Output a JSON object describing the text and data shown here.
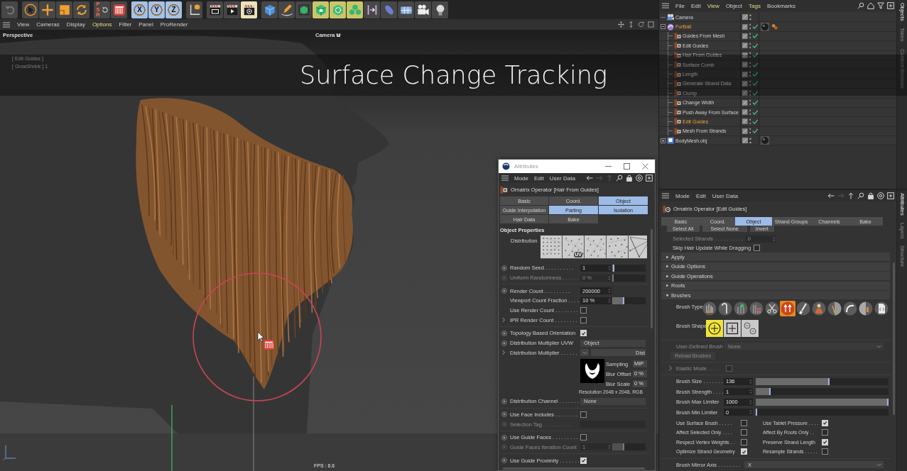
{
  "toolbar": [
    [
      {
        "kind": "undo",
        "active": false
      }
    ],
    [
      {
        "kind": "select",
        "active": false
      },
      {
        "kind": "move",
        "active": false
      },
      {
        "kind": "scale",
        "active": false
      },
      {
        "kind": "rotate",
        "active": false
      }
    ],
    [
      {
        "kind": "psr",
        "label": "PSR",
        "active": false
      },
      {
        "kind": "hair-tool",
        "active": false
      }
    ],
    [
      {
        "kind": "axis",
        "label": "X",
        "active": true
      },
      {
        "kind": "axis",
        "label": "Y",
        "active": true
      },
      {
        "kind": "axis",
        "label": "Z",
        "active": true
      }
    ],
    [
      {
        "kind": "coords",
        "active": false
      }
    ],
    [
      {
        "kind": "render-view",
        "active": false
      },
      {
        "kind": "render-picture",
        "active": false
      },
      {
        "kind": "render-settings",
        "active": true
      }
    ],
    [
      {
        "kind": "cube",
        "active": false
      },
      {
        "kind": "pen",
        "active": false
      },
      {
        "kind": "subdivision",
        "active": false
      },
      {
        "kind": "generator",
        "active": true
      },
      {
        "kind": "gear-cube",
        "active": true
      },
      {
        "kind": "cubes",
        "active": true
      },
      {
        "kind": "deformer",
        "active": false
      },
      {
        "kind": "field",
        "active": false
      },
      {
        "kind": "floor",
        "active": false
      },
      {
        "kind": "camera",
        "active": false
      },
      {
        "kind": "light",
        "active": false
      }
    ]
  ],
  "viewport": {
    "menu": [
      {
        "label": "View",
        "highlighted": false
      },
      {
        "label": "Cameras",
        "highlighted": false
      },
      {
        "label": "Display",
        "highlighted": false
      },
      {
        "label": "Options",
        "highlighted": true
      },
      {
        "label": "Filter",
        "highlighted": false
      },
      {
        "label": "Panel",
        "highlighted": false
      },
      {
        "label": "ProRender",
        "highlighted": false
      }
    ],
    "view_name": "Perspective",
    "camera": "Camera",
    "hud": [
      "[ Edit Guides ]",
      "[ GrowShrink ] 1"
    ],
    "fps": "FPS : 6.6"
  },
  "caption": "Surface Change Tracking",
  "attributes_window": {
    "title": "Attributes",
    "menu": [
      "Mode",
      "Edit",
      "User Data"
    ],
    "menu_icons": [
      {
        "kind": "back",
        "disabled": false
      },
      {
        "kind": "forward",
        "disabled": true
      },
      {
        "kind": "up",
        "disabled": true
      },
      {
        "kind": "search",
        "disabled": false
      },
      {
        "kind": "lock",
        "disabled": false
      },
      {
        "kind": "target",
        "disabled": false
      },
      {
        "kind": "new-panel",
        "disabled": false
      }
    ],
    "object": "Ornatrix Operator [Hair From Guides]",
    "tabs": [
      {
        "label": "Basic",
        "selected": false
      },
      {
        "label": "Coord.",
        "selected": false
      },
      {
        "label": "Object",
        "selected": true
      },
      {
        "label": "Guide Interpolation",
        "selected": false
      },
      {
        "label": "Parting",
        "selected": true
      },
      {
        "label": "Isolation",
        "selected": true
      },
      {
        "label": "Hair Data",
        "selected": false
      },
      {
        "label": "Bake",
        "selected": false
      }
    ],
    "section": "Object Properties",
    "distribution": {
      "label": "Distribution",
      "options": [
        {
          "kind": "grid",
          "selected": false
        },
        {
          "kind": "scatter",
          "badge": "UV",
          "selected": false
        },
        {
          "kind": "scatter",
          "selected": false
        },
        {
          "kind": "even",
          "selected": false
        },
        {
          "kind": "mesh",
          "selected": false
        }
      ]
    },
    "groups": [
      [
        {
          "kind": "number",
          "label": "Random Seed . . . . . . . . . .",
          "value": "1",
          "keyframe": true,
          "expandable": false,
          "disabled": false,
          "level": 0.02
        },
        {
          "kind": "number",
          "label": "Uniform Randomness . . . . . .",
          "value": "0 %",
          "keyframe": true,
          "expandable": false,
          "disabled": true,
          "level": 0
        }
      ],
      [
        {
          "kind": "number",
          "label": "Render Count . . . . . . . . .",
          "value": "200000",
          "keyframe": true,
          "expandable": false,
          "disabled": false
        },
        {
          "kind": "number",
          "label": "Viewport Count Fraction . . . .",
          "value": "10 %",
          "keyframe": false,
          "expandable": false,
          "disabled": false,
          "level": 0.34
        },
        {
          "kind": "checkbox",
          "label": "Use Render Count . . . . . . . .",
          "checked": false,
          "keyframe": false,
          "expandable": false,
          "disabled": false
        },
        {
          "kind": "checkbox",
          "label": "IPR Render Count . . . . . . . .",
          "checked": false,
          "keyframe": false,
          "expandable": true,
          "disabled": false
        }
      ],
      [
        {
          "kind": "checkbox",
          "label": "Topology Based Orientation",
          "checked": true,
          "keyframe": true,
          "expandable": false,
          "disabled": false
        },
        {
          "kind": "dropdown",
          "label": "Distribution Multiplier UVW",
          "value": "Object",
          "keyframe": true,
          "expandable": false,
          "disabled": false
        },
        {
          "kind": "shader",
          "label": "Distribution Multiplier . . . . . .",
          "button": "Dist",
          "keyframe": false,
          "expandable": true,
          "disabled": false
        },
        {
          "kind": "bitmap",
          "props": [
            {
              "label": "Sampling",
              "value": "MIP"
            },
            {
              "label": "Blur Offset",
              "value": "0 %"
            },
            {
              "label": "Blur Scale",
              "value": "0 %"
            }
          ]
        },
        {
          "kind": "note",
          "text": "Resolution 2048 x 2048, RGB"
        },
        {
          "kind": "dropdown",
          "label": "Distribution Channel . . . . . . .",
          "value": "None",
          "keyframe": true,
          "expandable": false,
          "disabled": false
        }
      ],
      [
        {
          "kind": "checkbox",
          "label": "Use Face Includes . . . . . . . .",
          "checked": false,
          "keyframe": true,
          "expandable": false,
          "disabled": false
        },
        {
          "kind": "field",
          "label": "Selection Tag . . . . . . . . . .",
          "keyframe": true,
          "expandable": false,
          "disabled": true
        }
      ],
      [
        {
          "kind": "checkbox",
          "label": "Use Guide Faces . . . . . . . . .",
          "checked": false,
          "keyframe": true,
          "expandable": false,
          "disabled": false
        },
        {
          "kind": "number",
          "label": "Guide Faces Iteration Count",
          "value": "1",
          "keyframe": true,
          "expandable": false,
          "disabled": true,
          "level": 0.34
        }
      ],
      [
        {
          "kind": "checkbox",
          "label": "Use Guide Proximity . . . . . . .",
          "checked": true,
          "keyframe": true,
          "expandable": false,
          "disabled": false
        }
      ]
    ]
  },
  "object_manager": {
    "menu": [
      {
        "label": "File",
        "highlighted": false
      },
      {
        "label": "Edit",
        "highlighted": false
      },
      {
        "label": "View",
        "highlighted": true
      },
      {
        "label": "Object",
        "highlighted": false
      },
      {
        "label": "Tags",
        "highlighted": true
      },
      {
        "label": "Bookmarks",
        "highlighted": false
      }
    ],
    "menu_icons": [
      {
        "kind": "search",
        "disabled": false
      },
      {
        "kind": "home",
        "disabled": false
      },
      {
        "kind": "filter",
        "disabled": false
      },
      {
        "kind": "new-panel",
        "disabled": false
      }
    ],
    "tree": [
      {
        "name": "Camera",
        "kind": "camera",
        "selected": false
      },
      {
        "name": "FurBall",
        "kind": "furball",
        "selected": true,
        "expanded": true,
        "enabled": true,
        "tags": [
          {
            "kind": "material"
          },
          {
            "kind": "hair"
          }
        ],
        "children": [
          {
            "name": "Guides From Mesh",
            "kind": "operator",
            "selected": false,
            "enabled": true
          },
          {
            "name": "Edit Guides",
            "kind": "operator",
            "selected": false,
            "enabled": true
          },
          {
            "name": "Hair From Guides",
            "kind": "operator",
            "selected": false,
            "enabled": true
          },
          {
            "name": "Surface Comb",
            "kind": "operator",
            "selected": false,
            "enabled": true
          },
          {
            "name": "Length",
            "kind": "operator",
            "selected": false,
            "enabled": true
          },
          {
            "name": "Generate Strand Data",
            "kind": "operator",
            "selected": false,
            "enabled": true
          },
          {
            "name": "Clump",
            "kind": "operator",
            "selected": false,
            "enabled": true
          },
          {
            "name": "Change Width",
            "kind": "operator",
            "selected": false,
            "enabled": true
          },
          {
            "name": "Push Away From Surface",
            "kind": "operator",
            "selected": false,
            "enabled": true
          },
          {
            "name": "Edit Guides",
            "kind": "operator",
            "selected": true,
            "enabled": true
          },
          {
            "name": "Mesh From Strands",
            "kind": "operator",
            "selected": false,
            "enabled": true
          }
        ]
      },
      {
        "name": "BodyMesh.obj",
        "kind": "mesh",
        "selected": false,
        "expanded": false,
        "tags": [
          {
            "kind": "material"
          }
        ]
      }
    ],
    "side_tabs": [
      {
        "label": "Objects",
        "selected": true
      },
      {
        "label": "Takes",
        "selected": false
      },
      {
        "label": "Content Browser",
        "selected": false
      }
    ]
  },
  "attribute_manager": {
    "menu": [
      "Mode",
      "Edit",
      "User Data"
    ],
    "menu_icons": [
      {
        "kind": "back",
        "disabled": false
      },
      {
        "kind": "forward",
        "disabled": true
      },
      {
        "kind": "up",
        "disabled": false
      },
      {
        "kind": "search",
        "disabled": false
      },
      {
        "kind": "lock",
        "disabled": false
      },
      {
        "kind": "target",
        "disabled": false
      },
      {
        "kind": "new-panel",
        "disabled": false
      }
    ],
    "object": "Ornatrix Operator [Edit Guides]",
    "tabs": [
      {
        "label": "Basic",
        "selected": false
      },
      {
        "label": "Coord.",
        "selected": false
      },
      {
        "label": "Object",
        "selected": true
      },
      {
        "label": "Strand Groups",
        "selected": false
      },
      {
        "label": "Channels",
        "selected": false
      },
      {
        "label": "Bake",
        "selected": false
      }
    ],
    "buttons": [
      "Select All",
      "Select None",
      "Invert"
    ],
    "selected_strands": {
      "label": "Selected Strands . . . . . . . . . .",
      "value": "0",
      "disabled": true
    },
    "skip_update": {
      "label": "Skip Hair Update While Dragging",
      "checked": false
    },
    "sections": [
      {
        "label": "Apply",
        "expanded": false
      },
      {
        "label": "Guide Options",
        "expanded": false
      },
      {
        "label": "Guide Operations",
        "expanded": false
      },
      {
        "label": "Roots",
        "expanded": false
      },
      {
        "label": "Brushes",
        "expanded": true
      }
    ],
    "brush_type": {
      "label": "Brush Type",
      "brushes": [
        {
          "kind": "strands",
          "selected": false
        },
        {
          "kind": "hook",
          "selected": false
        },
        {
          "kind": "plant",
          "selected": false
        },
        {
          "kind": "trim",
          "selected": false
        },
        {
          "kind": "scissors",
          "selected": false
        },
        {
          "kind": "arrows",
          "selected": true
        },
        {
          "kind": "brush",
          "selected": false
        },
        {
          "kind": "figure",
          "selected": false
        },
        {
          "kind": "split",
          "selected": false
        },
        {
          "kind": "curve",
          "selected": false
        },
        {
          "kind": "comb",
          "selected": false
        },
        {
          "kind": "script",
          "selected": false
        }
      ]
    },
    "brush_shape": {
      "label": "Brush Shape",
      "shapes": [
        {
          "kind": "circle",
          "selected": true
        },
        {
          "kind": "square",
          "selected": false
        },
        {
          "kind": "dots",
          "selected": false
        }
      ]
    },
    "user_brush": {
      "label": "User-Defined Brush",
      "value": "None",
      "disabled": true
    },
    "reload": {
      "label": "Reload Brushes",
      "disabled": true
    },
    "elastic": {
      "label": "Elastic Mode . . . .",
      "checked": false,
      "disabled": true
    },
    "sliders": [
      {
        "label": "Brush Size . . . . . . .",
        "value": "136",
        "level": 0.55
      },
      {
        "label": "Brush Strength . . . .",
        "value": "1",
        "level": 0.1
      },
      {
        "label": "Brush Max Limiter",
        "value": "1000",
        "level": 1
      },
      {
        "label": "Brush Min Limiter",
        "value": "0",
        "level": 0
      }
    ],
    "options": [
      {
        "label": "Use Surface Brush . . . . .",
        "checked": false
      },
      {
        "label": "Use Tablet Pressure . . . .",
        "checked": true
      },
      {
        "label": "Affect Selected Only . . . .",
        "checked": false
      },
      {
        "label": "Affect By Roots Only . .",
        "checked": false
      },
      {
        "label": "Respect Vertex Weights . .",
        "checked": false
      },
      {
        "label": "Preserve Strand Length",
        "checked": true
      },
      {
        "label": "Optimize Strand Geometry",
        "checked": true
      },
      {
        "label": "Resample Strands . . . . .",
        "checked": false
      }
    ],
    "mirror": {
      "label": "Brush Mirror Axis . . . . . . . .",
      "value": "X"
    },
    "side_tabs": [
      {
        "label": "Attributes",
        "selected": true
      },
      {
        "label": "Layers",
        "selected": false
      },
      {
        "label": "Structure",
        "selected": false
      }
    ]
  }
}
